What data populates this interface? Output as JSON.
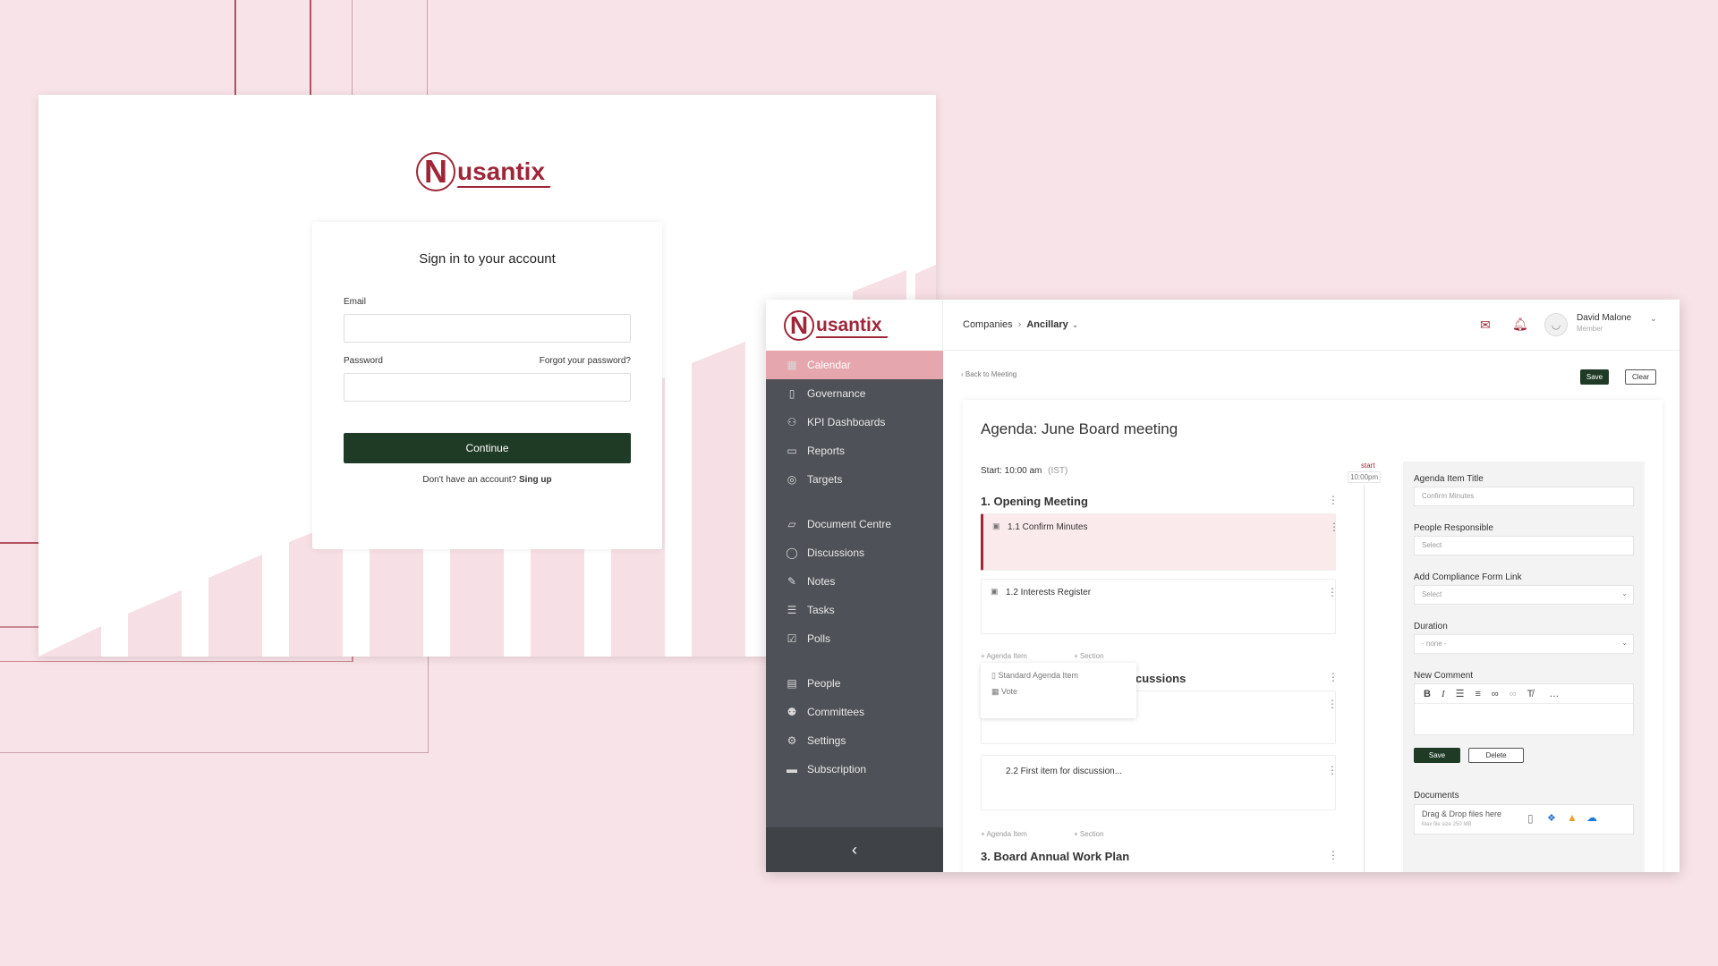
{
  "colors": {
    "background": "#f8e3e8",
    "brand": "#9e2638",
    "dark_green": "#1f3b26",
    "sidebar": "#4e5157",
    "active": "#e5a6ad"
  },
  "brand": {
    "logo_letter": "N",
    "logo_rest": "usantix"
  },
  "login": {
    "title": "Sign in to your account",
    "email_label": "Email",
    "password_label": "Password",
    "forgot": "Forgot your password?",
    "continue": "Continue",
    "no_account": "Don't have an account?",
    "signup": "Sing up"
  },
  "app": {
    "breadcrumb": {
      "first": "Companies",
      "second": "Ancillary"
    },
    "user": {
      "name": "David Malone",
      "role": "Member"
    },
    "sidebar": [
      {
        "label": "Calendar",
        "icon": "calendar-icon",
        "glyph": "▦",
        "active": true
      },
      {
        "label": "Governance",
        "icon": "document-icon",
        "glyph": "▯"
      },
      {
        "label": "KPI Dashboards",
        "icon": "dashboard-icon",
        "glyph": "⚇"
      },
      {
        "label": "Reports",
        "icon": "folder-icon",
        "glyph": "▭"
      },
      {
        "label": "Targets",
        "icon": "target-icon",
        "glyph": "◎"
      },
      {
        "label": "Document Centre",
        "icon": "folder-open-icon",
        "glyph": "▱"
      },
      {
        "label": "Discussions",
        "icon": "chat-icon",
        "glyph": "◯"
      },
      {
        "label": "Notes",
        "icon": "edit-icon",
        "glyph": "✎"
      },
      {
        "label": "Tasks",
        "icon": "list-icon",
        "glyph": "☰"
      },
      {
        "label": "Polls",
        "icon": "checkbox-icon",
        "glyph": "☑"
      },
      {
        "label": "People",
        "icon": "id-card-icon",
        "glyph": "▤"
      },
      {
        "label": "Committees",
        "icon": "users-icon",
        "glyph": "⚉"
      },
      {
        "label": "Settings",
        "icon": "gears-icon",
        "glyph": "⚙"
      },
      {
        "label": "Subscription",
        "icon": "card-icon",
        "glyph": "▬"
      }
    ],
    "back": "Back to Meeting",
    "save": "Save",
    "clear": "Clear",
    "agenda_title": "Agenda: June Board meeting",
    "start_label": "Start: 10:00 am",
    "timezone": "(IST)",
    "timeline_start": "start",
    "timeline_time": "10:00pm",
    "sections": {
      "s1": "1. Opening Meeting",
      "i11": "1.1 Confirm Minutes",
      "i12": "1.2 Interests Register",
      "add_item": "+ Agenda Item",
      "add_section": "+ Section",
      "menu_standard": "Standard Agenda Item",
      "menu_vote": "Vote",
      "s2_partial": "cussions",
      "i22": "2.2 First item for discussion...",
      "s3": "3. Board Annual Work Plan"
    },
    "right": {
      "title_label": "Agenda Item Title",
      "title_value": "Confirm Minutes",
      "people_label": "People Responsible",
      "people_placeholder": "Select",
      "compliance_label": "Add Compliance Form Link",
      "compliance_placeholder": "Select",
      "duration_label": "Duration",
      "duration_value": "- none -",
      "comment_label": "New Comment",
      "save": "Save",
      "delete": "Delete",
      "documents_label": "Documents",
      "drop_text": "Drag & Drop files here",
      "max_size": "Max file size 250 MB"
    }
  }
}
